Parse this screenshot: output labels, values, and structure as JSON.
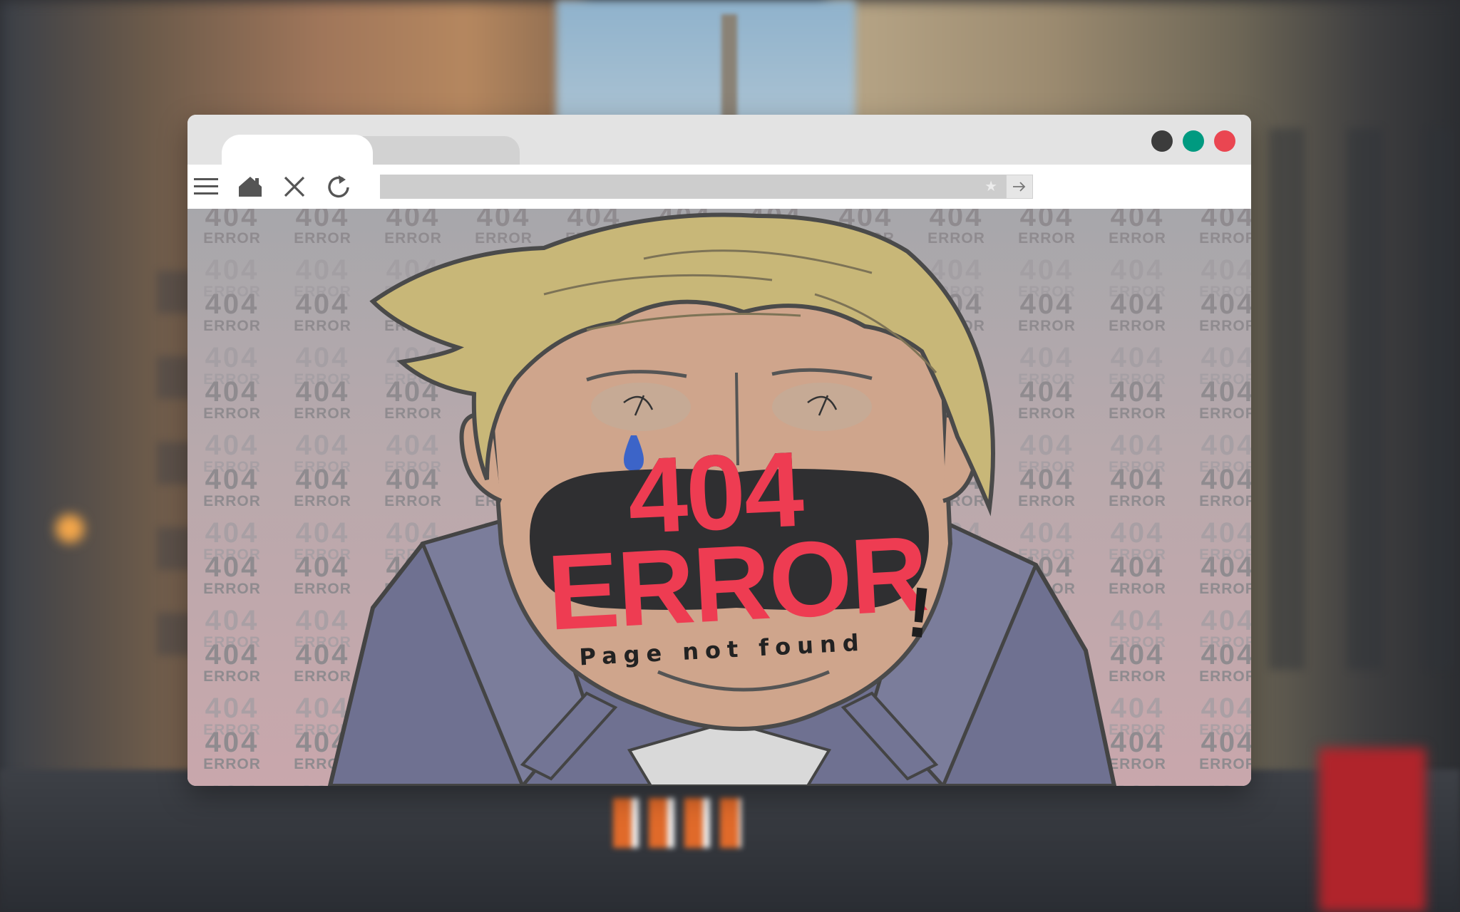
{
  "colors": {
    "accent_red": "#ee3c52",
    "window_dark": "#3c3c3c",
    "window_teal": "#009a80",
    "window_red": "#ea4651"
  },
  "toolbar": {
    "icons": [
      "menu-icon",
      "home-icon",
      "close-icon",
      "reload-icon"
    ],
    "address": "",
    "bookmark_icon": "star-icon",
    "go_icon": "arrow-right-icon"
  },
  "page": {
    "pattern_number": "404",
    "pattern_word": "ERROR",
    "headline_number": "404",
    "headline_word": "ERROR",
    "exclaim": "!",
    "subtitle": "Page not found"
  }
}
